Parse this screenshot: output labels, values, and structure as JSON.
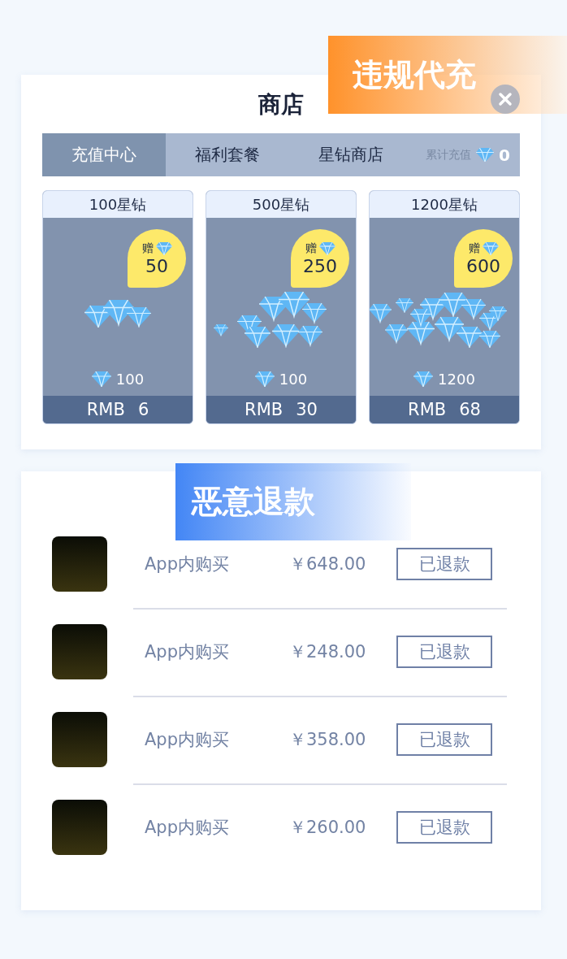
{
  "title": "商店",
  "banner_top": "违规代充",
  "tabs": [
    {
      "label": "充值中心",
      "selected": true
    },
    {
      "label": "福利套餐",
      "selected": false
    },
    {
      "label": "星钻商店",
      "selected": false
    }
  ],
  "total": {
    "label": "累计充值",
    "value": "0"
  },
  "packages": [
    {
      "name": "100星钻",
      "bonus_label": "赠",
      "bonus": "50",
      "amount": "100",
      "currency": "RMB",
      "price": "6"
    },
    {
      "name": "500星钻",
      "bonus_label": "赠",
      "bonus": "250",
      "amount": "100",
      "currency": "RMB",
      "price": "30"
    },
    {
      "name": "1200星钻",
      "bonus_label": "赠",
      "bonus": "600",
      "amount": "1200",
      "currency": "RMB",
      "price": "68"
    }
  ],
  "banner_bottom": "恶意退款",
  "refunds": [
    {
      "description": "App内购买",
      "price": "￥648.00",
      "status": "已退款"
    },
    {
      "description": "App内购买",
      "price": "￥248.00",
      "status": "已退款"
    },
    {
      "description": "App内购买",
      "price": "￥358.00",
      "status": "已退款"
    },
    {
      "description": "App内购买",
      "price": "￥260.00",
      "status": "已退款"
    }
  ]
}
